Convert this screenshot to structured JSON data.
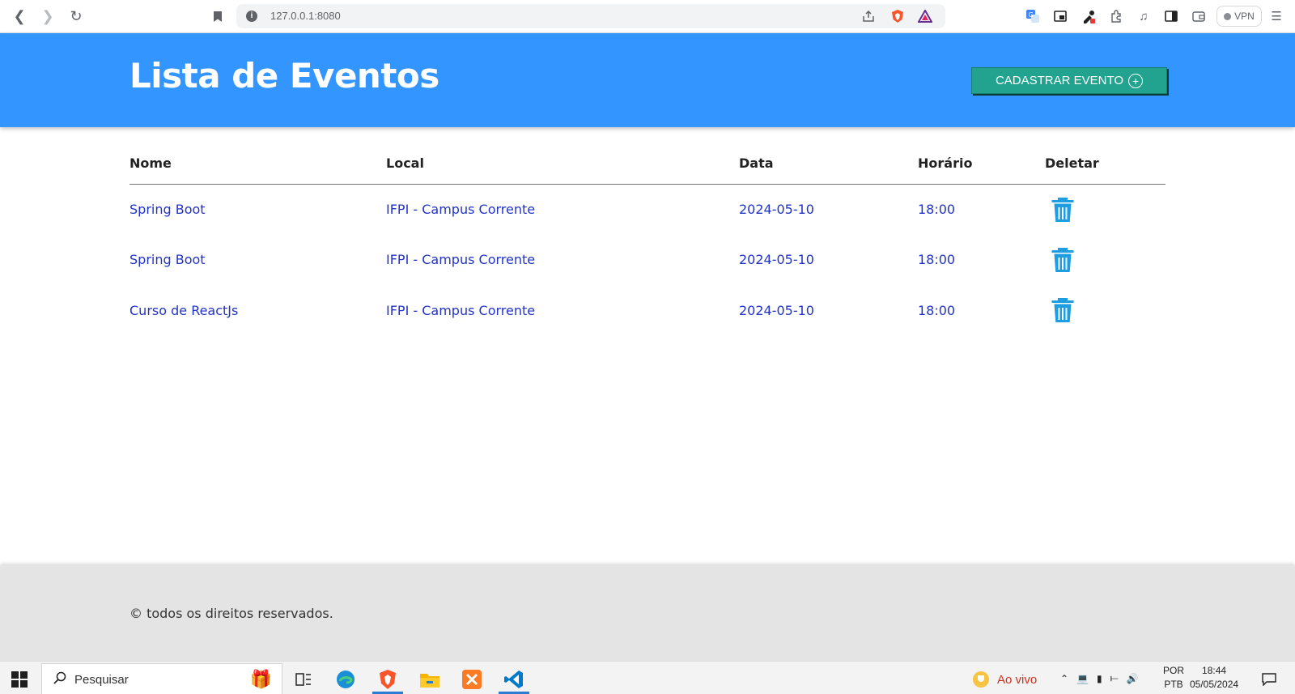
{
  "browser": {
    "url": "127.0.0.1:8080",
    "vpn_label": "VPN"
  },
  "header": {
    "title": "Lista de Eventos",
    "add_button_label": "CADASTRAR EVENTO",
    "accent_color": "#3395ff",
    "button_color": "#21a38f"
  },
  "table": {
    "columns": [
      "Nome",
      "Local",
      "Data",
      "Horário",
      "Deletar"
    ],
    "rows": [
      {
        "nome": "Spring Boot",
        "local": "IFPI - Campus Corrente",
        "data": "2024-05-10",
        "horario": "18:00"
      },
      {
        "nome": "Spring Boot",
        "local": "IFPI - Campus Corrente",
        "data": "2024-05-10",
        "horario": "18:00"
      },
      {
        "nome": "Curso de ReactJs",
        "local": "IFPI - Campus Corrente",
        "data": "2024-05-10",
        "horario": "18:00"
      }
    ],
    "delete_icon": "trash-icon",
    "link_color": "#2233c8",
    "icon_color": "#1e9de0"
  },
  "footer": {
    "text": "© todos os direitos reservados."
  },
  "taskbar": {
    "search_placeholder": "Pesquisar",
    "news_label": "Ao vivo",
    "lang_top": "POR",
    "lang_bottom": "PTB",
    "time": "18:44",
    "date": "05/05/2024"
  }
}
